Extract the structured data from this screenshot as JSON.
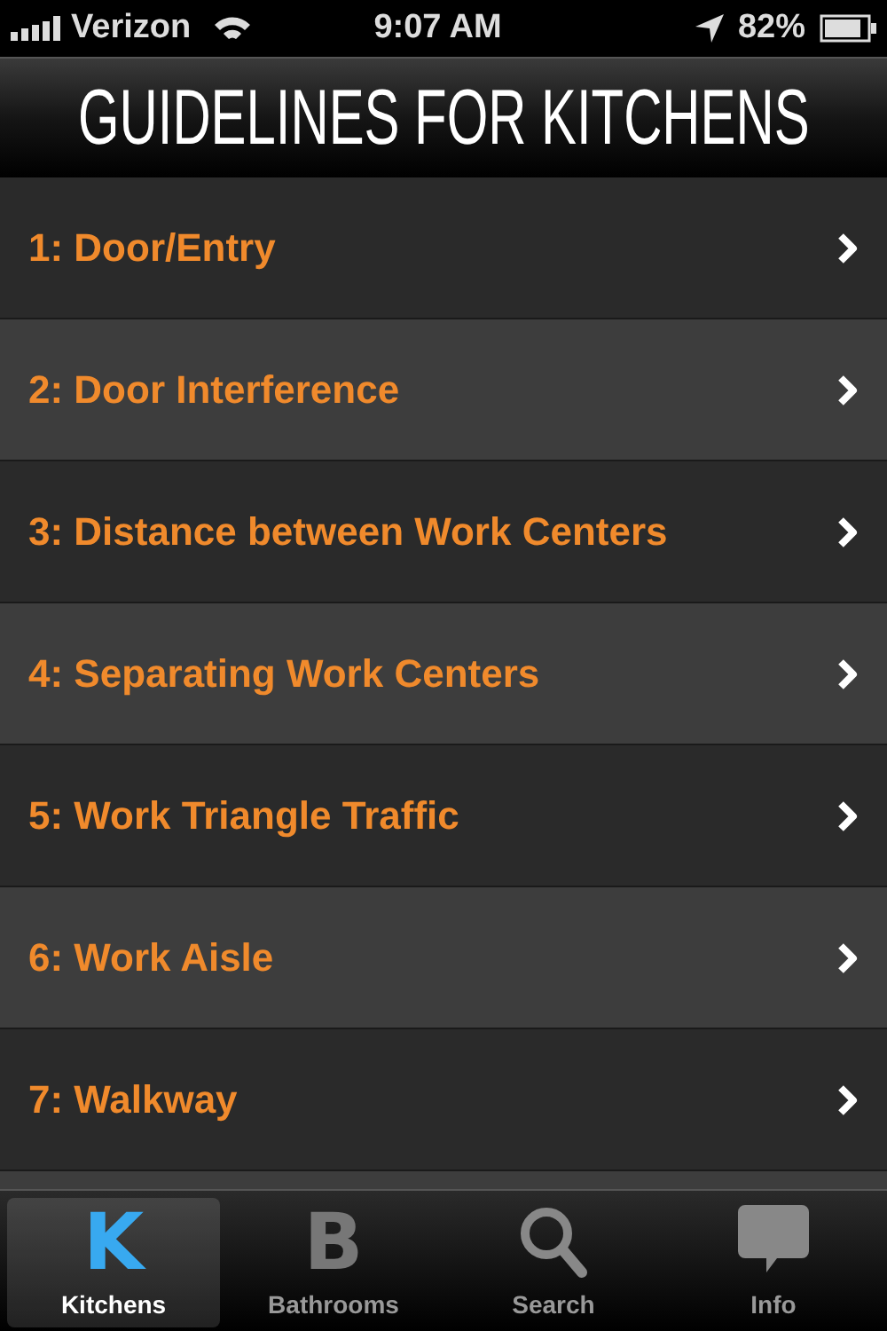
{
  "status_bar": {
    "carrier": "Verizon",
    "time": "9:07 AM",
    "battery": "82%"
  },
  "title": "GUIDELINES FOR KITCHENS",
  "items": [
    {
      "label": "1: Door/Entry"
    },
    {
      "label": "2: Door Interference"
    },
    {
      "label": "3: Distance between Work Centers"
    },
    {
      "label": "4: Separating Work Centers"
    },
    {
      "label": "5: Work Triangle Traffic"
    },
    {
      "label": "6: Work Aisle"
    },
    {
      "label": "7: Walkway"
    }
  ],
  "tabs": [
    {
      "label": "Kitchens",
      "kind": "letter",
      "glyph": "K",
      "selected": true
    },
    {
      "label": "Bathrooms",
      "kind": "letter",
      "glyph": "B",
      "selected": false
    },
    {
      "label": "Search",
      "kind": "search",
      "selected": false
    },
    {
      "label": "Info",
      "kind": "info",
      "selected": false
    }
  ]
}
